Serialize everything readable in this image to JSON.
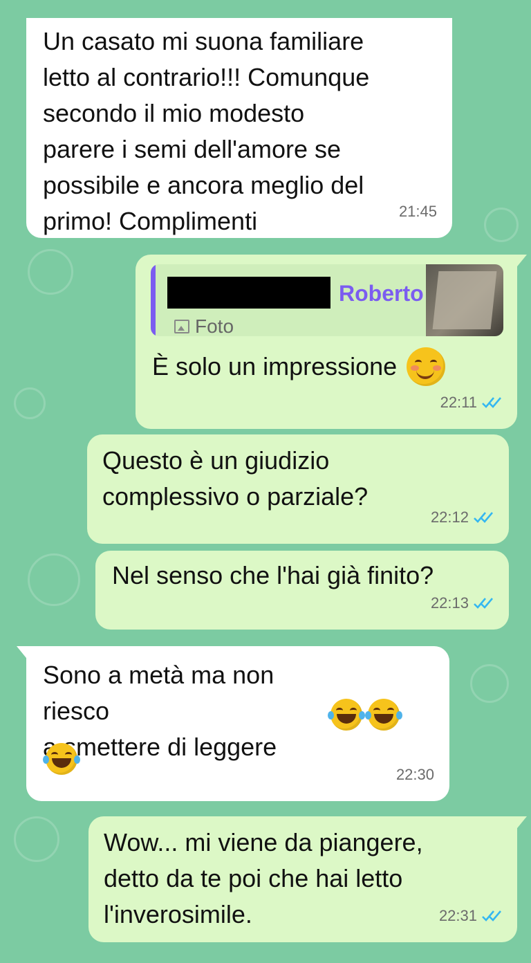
{
  "messages": [
    {
      "id": "m1",
      "dir": "in",
      "text": "Un casato mi suona familiare\nletto al contrario!!! Comunque\nsecondo il mio modesto\nparere i semi dell'amore se\npossibile e ancora meglio del\nprimo! Complimenti",
      "time": "21:45"
    },
    {
      "id": "m2",
      "dir": "out",
      "quote": {
        "name": "Roberto",
        "media_label": "Foto"
      },
      "text": "È solo un impressione",
      "emoji": "smirk-face-icon",
      "time": "22:11",
      "status": "read"
    },
    {
      "id": "m3",
      "dir": "out",
      "text": "Questo è un giudizio\ncomplessivo o parziale?",
      "time": "22:12",
      "status": "read"
    },
    {
      "id": "m4",
      "dir": "out",
      "text": "Nel senso che l'hai già finito?",
      "time": "22:13",
      "status": "read"
    },
    {
      "id": "m5",
      "dir": "in",
      "text": "Sono a metà ma non riesco\na smettere di leggere",
      "emoji_count": 3,
      "emoji": "tears-of-joy-icon",
      "time": "22:30"
    },
    {
      "id": "m6",
      "dir": "out",
      "text": "Wow... mi viene da piangere,\ndetto da te poi che hai letto\nl'inverosimile.",
      "time": "22:31",
      "status": "read"
    }
  ],
  "colors": {
    "wallpaper": "#7ccba2",
    "incoming": "#ffffff",
    "outgoing": "#dcf8c6",
    "read_tick": "#34b7f1",
    "quote_accent": "#7b5cf0"
  }
}
